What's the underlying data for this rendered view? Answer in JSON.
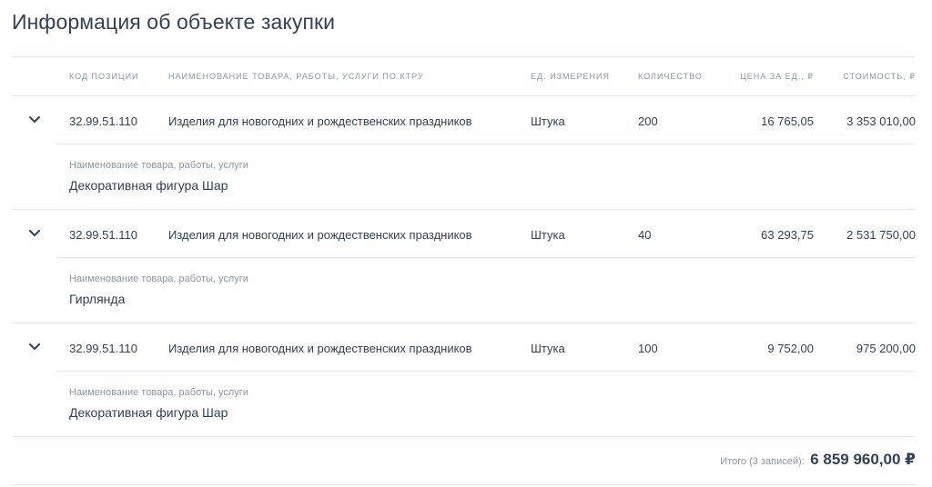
{
  "page": {
    "title": "Информация об объекте закупки"
  },
  "table": {
    "headers": {
      "code": "КОД ПОЗИЦИИ",
      "name": "НАИМЕНОВАНИЕ ТОВАРА, РАБОТЫ, УСЛУГИ ПО КТРУ",
      "unit": "ЕД. ИЗМЕРЕНИЯ",
      "qty": "КОЛИЧЕСТВО",
      "price": "ЦЕНА ЗА ЕД., ₽",
      "cost": "СТОИМОСТЬ, ₽"
    },
    "rows": [
      {
        "code": "32.99.51.110",
        "name": "Изделия для новогодних и рождественских праздников",
        "unit": "Штука",
        "qty": "200",
        "price": "16 765,05",
        "cost": "3 353 010,00",
        "detail_label": "Наименование товара, работы, услуги",
        "detail_value": "Декоративная фигура Шар"
      },
      {
        "code": "32.99.51.110",
        "name": "Изделия для новогодних и рождественских праздников",
        "unit": "Штука",
        "qty": "40",
        "price": "63 293,75",
        "cost": "2 531 750,00",
        "detail_label": "Наименование товара, работы, услуги",
        "detail_value": "Гирлянда"
      },
      {
        "code": "32.99.51.110",
        "name": "Изделия для новогодних и рождественских праздников",
        "unit": "Штука",
        "qty": "100",
        "price": "9 752,00",
        "cost": "975 200,00",
        "detail_label": "Наименование товара, работы, услуги",
        "detail_value": "Декоративная фигура Шар"
      }
    ]
  },
  "footer": {
    "total_label": "Итого (3 записей):",
    "total_value": "6 859 960,00 ₽"
  },
  "icons": {
    "expand": "chevron-down-icon"
  },
  "colors": {
    "text": "#334059",
    "muted": "#8b95a8",
    "divider": "#e4e7f2"
  }
}
